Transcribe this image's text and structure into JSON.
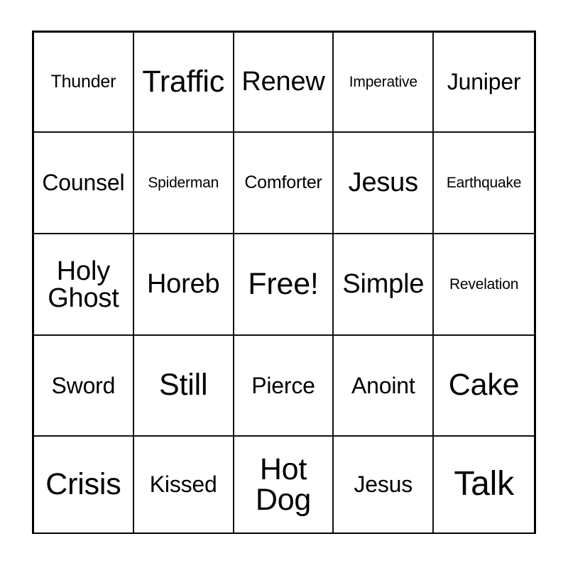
{
  "card": {
    "type": "bingo-card",
    "rows": 5,
    "columns": 5,
    "background_color": "#ffffff",
    "text_color": "#000000",
    "border_color": "#000000",
    "free_space": "Free!",
    "cells": [
      [
        {
          "text": "Thunder",
          "size": "sm"
        },
        {
          "text": "Traffic",
          "size": "xl"
        },
        {
          "text": "Renew",
          "size": "lg"
        },
        {
          "text": "Imperative",
          "size": "xs"
        },
        {
          "text": "Juniper",
          "size": "md"
        }
      ],
      [
        {
          "text": "Counsel",
          "size": "md"
        },
        {
          "text": "Spiderman",
          "size": "xs"
        },
        {
          "text": "Comforter",
          "size": "sm"
        },
        {
          "text": "Jesus",
          "size": "lg"
        },
        {
          "text": "Earthquake",
          "size": "xs"
        }
      ],
      [
        {
          "text": "Holy Ghost",
          "size": "lg",
          "lines": [
            "Holy",
            "Ghost"
          ]
        },
        {
          "text": "Horeb",
          "size": "lg"
        },
        {
          "text": "Free!",
          "size": "xl"
        },
        {
          "text": "Simple",
          "size": "lg"
        },
        {
          "text": "Revelation",
          "size": "xs"
        }
      ],
      [
        {
          "text": "Sword",
          "size": "md"
        },
        {
          "text": "Still",
          "size": "xl"
        },
        {
          "text": "Pierce",
          "size": "md"
        },
        {
          "text": "Anoint",
          "size": "md"
        },
        {
          "text": "Cake",
          "size": "xl"
        }
      ],
      [
        {
          "text": "Crisis",
          "size": "xl"
        },
        {
          "text": "Kissed",
          "size": "md"
        },
        {
          "text": "Hot Dog",
          "size": "xl",
          "lines": [
            "Hot",
            "Dog"
          ]
        },
        {
          "text": "Jesus",
          "size": "md"
        },
        {
          "text": "Talk",
          "size": "xxl"
        }
      ]
    ]
  }
}
